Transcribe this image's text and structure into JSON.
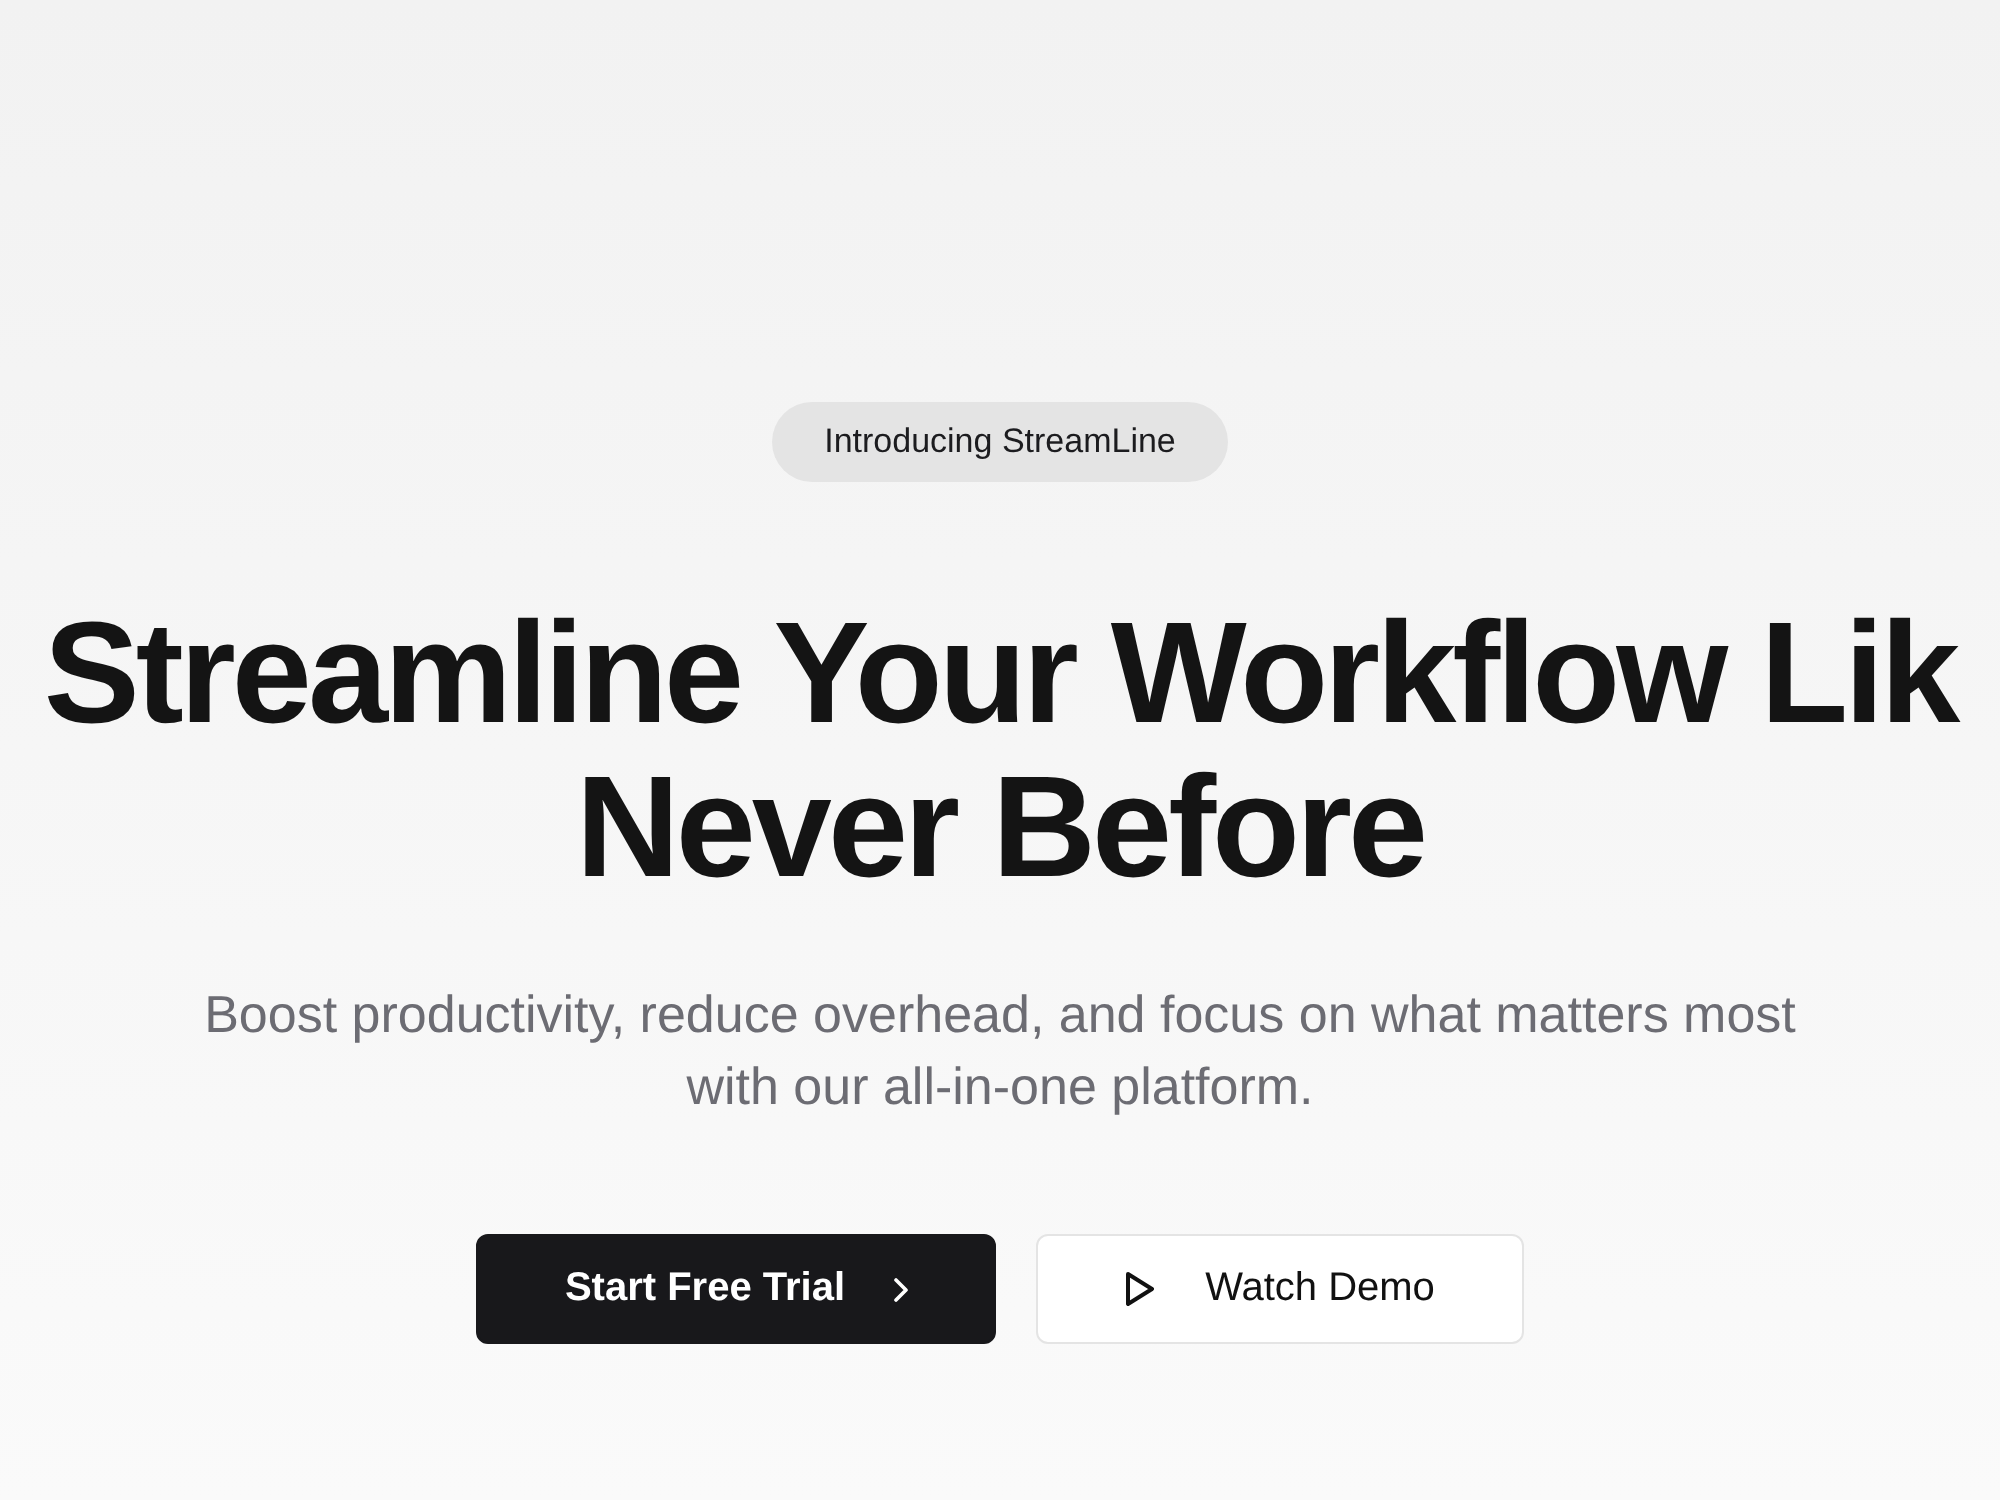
{
  "badge": {
    "label": "Introducing StreamLine"
  },
  "hero": {
    "heading_lines": [
      "Streamline Your Workflow Lik",
      "Never Before"
    ],
    "subtitle": "Boost productivity, reduce overhead, and focus on what matters most with our all-in-one platform."
  },
  "buttons": [
    {
      "kind": "primary",
      "label": "Start Free Trial"
    },
    {
      "kind": "secondary",
      "label": "Watch Demo"
    }
  ]
}
